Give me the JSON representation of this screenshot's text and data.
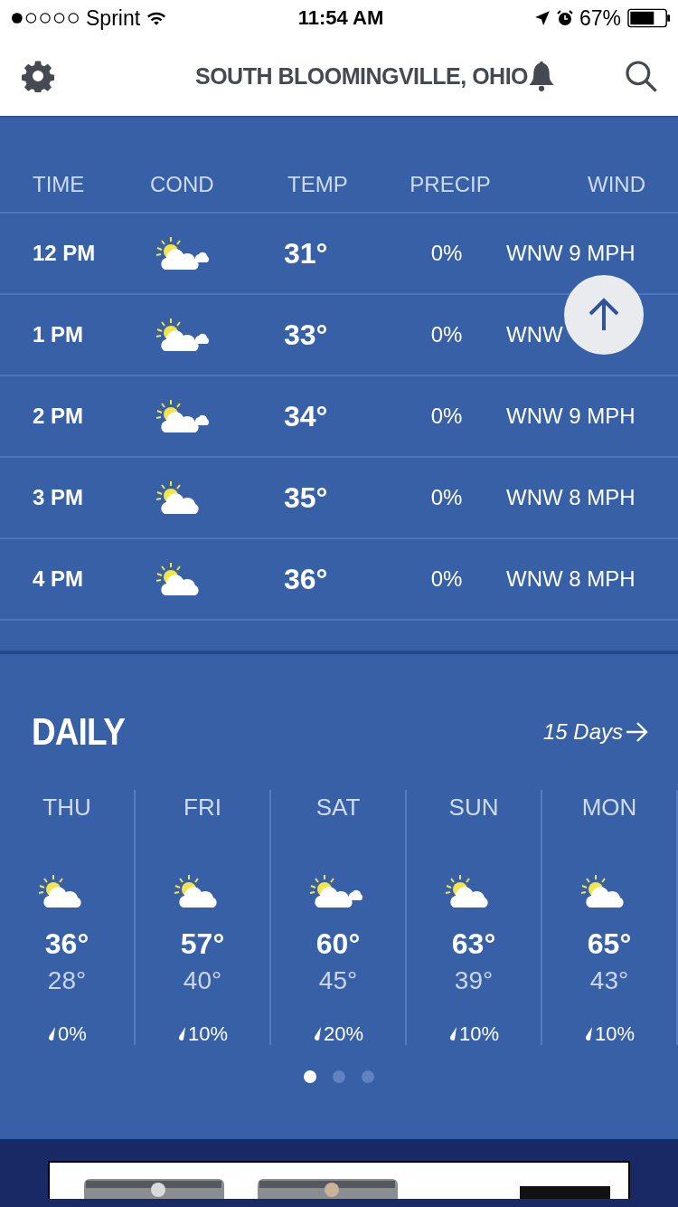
{
  "status_bar": {
    "carrier": "Sprint",
    "time": "11:54 AM",
    "battery": "67%"
  },
  "header": {
    "location": "SOUTH BLOOMINGVILLE, OHIO"
  },
  "hourly": {
    "columns": [
      "TIME",
      "COND",
      "TEMP",
      "PRECIP",
      "WIND"
    ],
    "rows": [
      {
        "time": "12 PM",
        "kind": "sun-clouds",
        "temp": "31°",
        "precip": "0%",
        "wind": "WNW 9 MPH"
      },
      {
        "time": "1 PM",
        "kind": "sun-clouds",
        "temp": "33°",
        "precip": "0%",
        "wind": "WNW"
      },
      {
        "time": "2 PM",
        "kind": "sun-clouds",
        "temp": "34°",
        "precip": "0%",
        "wind": "WNW 9 MPH"
      },
      {
        "time": "3 PM",
        "kind": "sun-cloud",
        "temp": "35°",
        "precip": "0%",
        "wind": "WNW 8 MPH"
      },
      {
        "time": "4 PM",
        "kind": "sun-cloud",
        "temp": "36°",
        "precip": "0%",
        "wind": "WNW 8 MPH"
      }
    ]
  },
  "daily": {
    "title": "DAILY",
    "link": "15 Days",
    "days": [
      {
        "day": "THU",
        "kind": "sun-cloud",
        "high": "36°",
        "low": "28°",
        "precip": "0%"
      },
      {
        "day": "FRI",
        "kind": "sun-cloud",
        "high": "57°",
        "low": "40°",
        "precip": "10%"
      },
      {
        "day": "SAT",
        "kind": "sun-clouds",
        "high": "60°",
        "low": "45°",
        "precip": "20%"
      },
      {
        "day": "SUN",
        "kind": "sun-cloud",
        "high": "63°",
        "low": "39°",
        "precip": "10%"
      },
      {
        "day": "MON",
        "kind": "sun-cloud",
        "high": "65°",
        "low": "43°",
        "precip": "10%"
      }
    ],
    "pages": [
      {
        "selected": true
      },
      {
        "selected": false
      },
      {
        "selected": false
      }
    ]
  }
}
